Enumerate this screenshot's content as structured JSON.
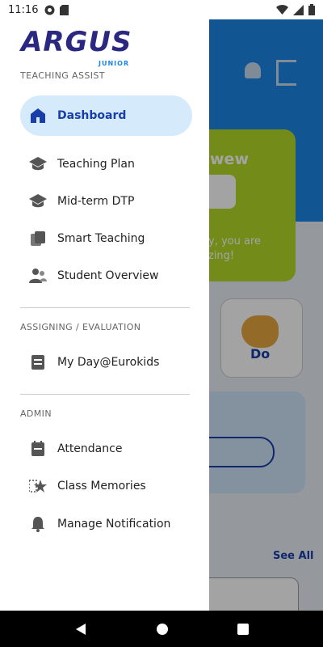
{
  "status_bar": {
    "time": "11:16"
  },
  "drawer": {
    "logo": {
      "word": "ARGUS",
      "sub": "JUNIOR"
    },
    "sections": [
      {
        "title": "TEACHING ASSIST"
      },
      {
        "title": "ASSIGNING / EVALUATION"
      },
      {
        "title": "ADMIN"
      }
    ],
    "items": [
      {
        "label": "Dashboard",
        "icon": "home-icon",
        "active": true
      },
      {
        "label": "Teaching Plan",
        "icon": "graduation-cap-icon"
      },
      {
        "label": "Mid-term DTP",
        "icon": "graduation-cap-icon"
      },
      {
        "label": "Smart Teaching",
        "icon": "layers-icon"
      },
      {
        "label": "Student Overview",
        "icon": "people-icon"
      },
      {
        "label": "My Day@Eurokids",
        "icon": "note-icon"
      },
      {
        "label": "Attendance",
        "icon": "clipboard-icon"
      },
      {
        "label": "Class Memories",
        "icon": "star-icon"
      },
      {
        "label": "Manage Notification",
        "icon": "bell-icon"
      }
    ]
  },
  "background": {
    "greeting": "wew",
    "message_line1": "y, you are",
    "message_line2": "zing!",
    "tile_text": "Do",
    "see_all": "See All"
  },
  "colors": {
    "accent": "#1a3ea8",
    "active_bg": "#d5ebfc",
    "hero": "#1b86e6",
    "green_card": "#b5dc28"
  }
}
